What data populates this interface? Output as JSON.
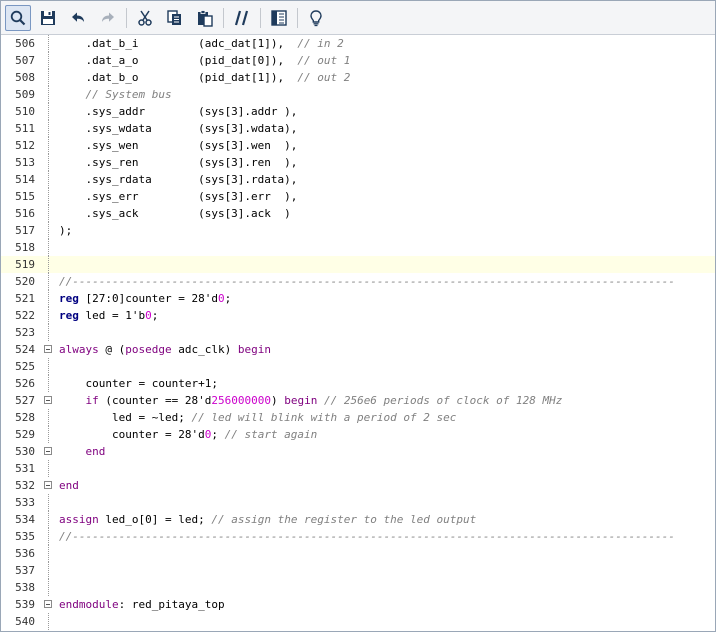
{
  "toolbar": {
    "buttons": [
      {
        "name": "search-icon",
        "active": true
      },
      {
        "name": "save-icon"
      },
      {
        "name": "undo-icon"
      },
      {
        "name": "redo-icon"
      },
      {
        "sep": true
      },
      {
        "name": "cut-icon"
      },
      {
        "name": "copy-icon"
      },
      {
        "name": "paste-icon"
      },
      {
        "sep": true
      },
      {
        "name": "comment-toggle-icon"
      },
      {
        "sep": true
      },
      {
        "name": "columns-icon"
      },
      {
        "sep": true
      },
      {
        "name": "lightbulb-icon"
      }
    ]
  },
  "lines": [
    {
      "n": "506",
      "fold": "line",
      "tokens": [
        {
          "t": "    .dat_b_i         (adc_dat[1]),  "
        },
        {
          "t": "// in 2",
          "c": "cmt"
        }
      ]
    },
    {
      "n": "507",
      "fold": "line",
      "tokens": [
        {
          "t": "    .dat_a_o         (pid_dat[0]),  "
        },
        {
          "t": "// out 1",
          "c": "cmt"
        }
      ]
    },
    {
      "n": "508",
      "fold": "line",
      "tokens": [
        {
          "t": "    .dat_b_o         (pid_dat[1]),  "
        },
        {
          "t": "// out 2",
          "c": "cmt"
        }
      ]
    },
    {
      "n": "509",
      "fold": "line",
      "tokens": [
        {
          "t": "    "
        },
        {
          "t": "// System bus",
          "c": "cmt"
        }
      ]
    },
    {
      "n": "510",
      "fold": "line",
      "tokens": [
        {
          "t": "    .sys_addr        (sys[3].addr ),"
        }
      ]
    },
    {
      "n": "511",
      "fold": "line",
      "tokens": [
        {
          "t": "    .sys_wdata       (sys[3].wdata),"
        }
      ]
    },
    {
      "n": "512",
      "fold": "line",
      "tokens": [
        {
          "t": "    .sys_wen         (sys[3].wen  ),"
        }
      ]
    },
    {
      "n": "513",
      "fold": "line",
      "tokens": [
        {
          "t": "    .sys_ren         (sys[3].ren  ),"
        }
      ]
    },
    {
      "n": "514",
      "fold": "line",
      "tokens": [
        {
          "t": "    .sys_rdata       (sys[3].rdata),"
        }
      ]
    },
    {
      "n": "515",
      "fold": "line",
      "tokens": [
        {
          "t": "    .sys_err         (sys[3].err  ),"
        }
      ]
    },
    {
      "n": "516",
      "fold": "line",
      "tokens": [
        {
          "t": "    .sys_ack         (sys[3].ack  )"
        }
      ]
    },
    {
      "n": "517",
      "fold": "line",
      "tokens": [
        {
          "t": ");"
        }
      ]
    },
    {
      "n": "518",
      "fold": "line",
      "tokens": []
    },
    {
      "n": "519",
      "fold": "line",
      "current": true,
      "tokens": []
    },
    {
      "n": "520",
      "fold": "line",
      "tokens": [
        {
          "t": "//-------------------------------------------------------------------------------------------",
          "c": "cmt"
        }
      ]
    },
    {
      "n": "521",
      "fold": "line",
      "tokens": [
        {
          "t": "reg",
          "c": "kw"
        },
        {
          "t": " [27:0]counter = 28'd"
        },
        {
          "t": "0",
          "c": "num"
        },
        {
          "t": ";"
        }
      ]
    },
    {
      "n": "522",
      "fold": "line",
      "tokens": [
        {
          "t": "reg",
          "c": "kw"
        },
        {
          "t": " led = 1'b"
        },
        {
          "t": "0",
          "c": "num"
        },
        {
          "t": ";"
        }
      ]
    },
    {
      "n": "523",
      "fold": "line",
      "tokens": []
    },
    {
      "n": "524",
      "fold": "box",
      "tokens": [
        {
          "t": "always",
          "c": "kw2"
        },
        {
          "t": " @ ("
        },
        {
          "t": "posedge",
          "c": "kw2"
        },
        {
          "t": " adc_clk) "
        },
        {
          "t": "begin",
          "c": "kw2"
        }
      ]
    },
    {
      "n": "525",
      "fold": "line",
      "tokens": []
    },
    {
      "n": "526",
      "fold": "line",
      "tokens": [
        {
          "t": "    counter = counter+1;"
        }
      ]
    },
    {
      "n": "527",
      "fold": "box",
      "tokens": [
        {
          "t": "    "
        },
        {
          "t": "if",
          "c": "kw2"
        },
        {
          "t": " (counter == 28'd"
        },
        {
          "t": "256000000",
          "c": "num"
        },
        {
          "t": ") "
        },
        {
          "t": "begin",
          "c": "kw2"
        },
        {
          "t": " "
        },
        {
          "t": "// 256e6 periods of clock of 128 MHz",
          "c": "cmt"
        }
      ]
    },
    {
      "n": "528",
      "fold": "line",
      "tokens": [
        {
          "t": "        led = ~led; "
        },
        {
          "t": "// led will blink with a period of 2 sec",
          "c": "cmt"
        }
      ]
    },
    {
      "n": "529",
      "fold": "line",
      "tokens": [
        {
          "t": "        counter = 28'd"
        },
        {
          "t": "0",
          "c": "num"
        },
        {
          "t": "; "
        },
        {
          "t": "// start again",
          "c": "cmt"
        }
      ]
    },
    {
      "n": "530",
      "fold": "box",
      "tokens": [
        {
          "t": "    "
        },
        {
          "t": "end",
          "c": "kw2"
        }
      ]
    },
    {
      "n": "531",
      "fold": "line",
      "tokens": []
    },
    {
      "n": "532",
      "fold": "box",
      "tokens": [
        {
          "t": "end",
          "c": "kw2"
        }
      ]
    },
    {
      "n": "533",
      "fold": "line",
      "tokens": []
    },
    {
      "n": "534",
      "fold": "line",
      "tokens": [
        {
          "t": "assign",
          "c": "kw2"
        },
        {
          "t": " led_o[0] = led; "
        },
        {
          "t": "// assign the register to the led output",
          "c": "cmt"
        }
      ]
    },
    {
      "n": "535",
      "fold": "line",
      "tokens": [
        {
          "t": "//-------------------------------------------------------------------------------------------",
          "c": "cmt"
        }
      ]
    },
    {
      "n": "536",
      "fold": "line",
      "tokens": []
    },
    {
      "n": "537",
      "fold": "line",
      "tokens": []
    },
    {
      "n": "538",
      "fold": "line",
      "tokens": []
    },
    {
      "n": "539",
      "fold": "box",
      "tokens": [
        {
          "t": "endmodule",
          "c": "kw2"
        },
        {
          "t": ": red_pitaya_top"
        }
      ]
    },
    {
      "n": "540",
      "fold": "line",
      "tokens": []
    }
  ]
}
